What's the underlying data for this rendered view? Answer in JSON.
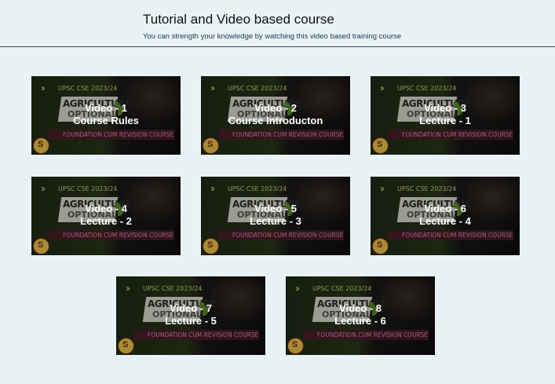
{
  "header": {
    "title": "Tutorial and Video based course",
    "subtitle": "You can strength your knowledge by watching this video based training course"
  },
  "thumbnail": {
    "exam_label": "UPSC CSE 2023/24",
    "heading_line1": "AGRICULTURE",
    "heading_line2": "OPTIONAL",
    "course_strip": "FOUNDATION CUM REVISION COURSE"
  },
  "videos": [
    {
      "line1": "Video - 1",
      "line2": "Course Rules"
    },
    {
      "line1": "Video - 2",
      "line2": "Course Introducton"
    },
    {
      "line1": "Video - 3",
      "line2": "Lecture - 1"
    },
    {
      "line1": "Video - 4",
      "line2": "Lecture - 2"
    },
    {
      "line1": "Video - 5",
      "line2": "Lecture - 3"
    },
    {
      "line1": "Video - 6",
      "line2": "Lecture - 4"
    },
    {
      "line1": "Video - 7",
      "line2": "Lecture - 5"
    },
    {
      "line1": "Video - 8",
      "line2": "Lecture - 6"
    }
  ]
}
